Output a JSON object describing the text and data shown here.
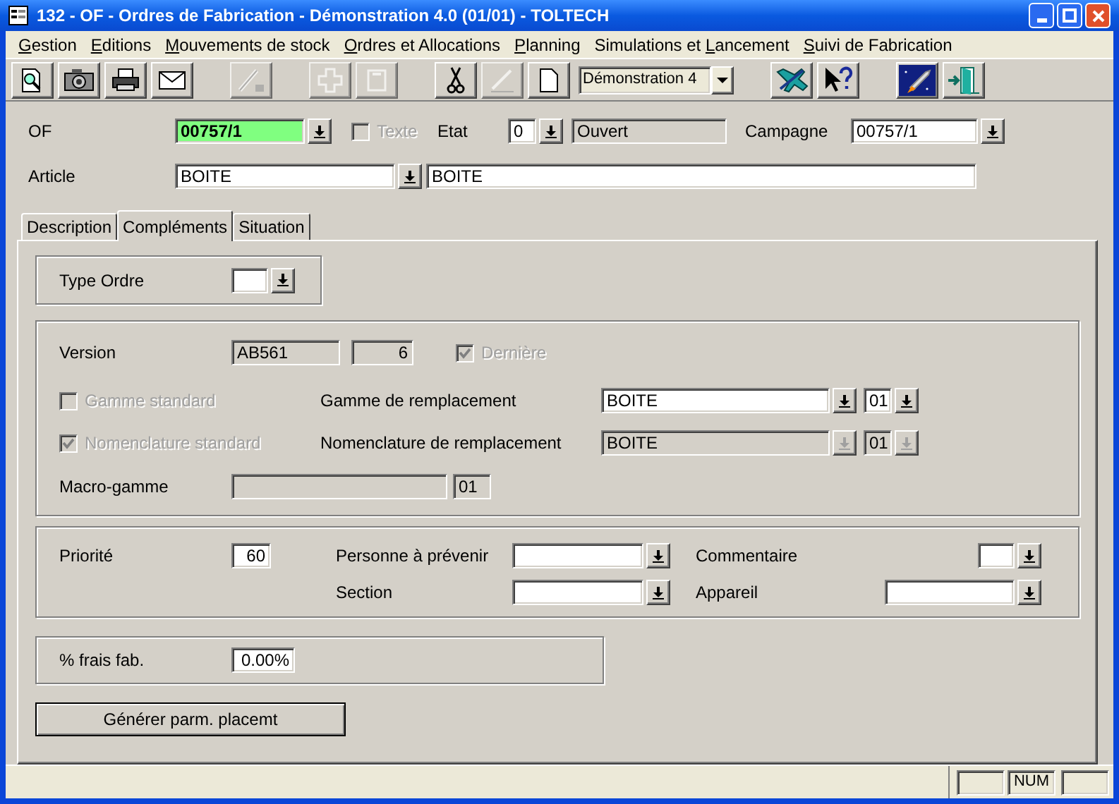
{
  "window": {
    "title": "132 - OF - Ordres de Fabrication - Démonstration 4.0 (01/01) - TOLTECH"
  },
  "menu": [
    {
      "key": "G",
      "post": "estion"
    },
    {
      "key": "E",
      "post": "ditions"
    },
    {
      "key": "M",
      "post": "ouvements de stock"
    },
    {
      "key": "O",
      "post": "rdres et Allocations"
    },
    {
      "key": "P",
      "post": "lanning"
    },
    {
      "pre": "Simulations et ",
      "key": "L",
      "post": "ancement"
    },
    {
      "key": "S",
      "post": "uivi de Fabrication"
    }
  ],
  "toolbar": [
    [
      {
        "kind": "button",
        "disabled": false
      },
      {
        "kind": "button",
        "disabled": false
      },
      {
        "kind": "button",
        "disabled": false
      },
      {
        "kind": "button",
        "disabled": false
      }
    ],
    [
      {
        "kind": "button",
        "disabled": true
      }
    ],
    [
      {
        "kind": "button",
        "disabled": true
      },
      {
        "kind": "button",
        "disabled": true
      }
    ],
    [
      {
        "kind": "button",
        "disabled": false
      },
      {
        "kind": "button",
        "disabled": true
      },
      {
        "kind": "button",
        "disabled": false
      },
      {
        "kind": "combo",
        "value": "Démonstration 4"
      }
    ],
    [
      {
        "kind": "button",
        "disabled": false
      },
      {
        "kind": "button",
        "disabled": false
      }
    ],
    [
      {
        "kind": "button",
        "disabled": false
      },
      {
        "kind": "button",
        "disabled": false
      }
    ]
  ],
  "header": {
    "of": {
      "label": "OF",
      "field": {
        "value": "00757/1",
        "highlighted": true,
        "disabled": false,
        "dropdown": {
          "disabled": false
        }
      }
    },
    "texte": {
      "label": "Texte",
      "checked": false,
      "disabled": true
    },
    "etat": {
      "label": "Etat",
      "code": {
        "value": "0",
        "disabled": false,
        "dropdown": {
          "disabled": false
        }
      },
      "status": {
        "value": "Ouvert",
        "disabled": true
      }
    },
    "campagne": {
      "label": "Campagne",
      "field": {
        "value": "00757/1",
        "disabled": false,
        "dropdown": {
          "disabled": false
        }
      }
    },
    "article": {
      "label": "Article",
      "code": {
        "value": "BOITE",
        "disabled": false,
        "dropdown": {
          "disabled": false
        }
      },
      "description": {
        "value": "BOITE",
        "disabled": false
      }
    }
  },
  "tabs": [
    {
      "label": "Description",
      "selected": false
    },
    {
      "label": "Compléments",
      "selected": true
    },
    {
      "label": "Situation",
      "selected": false
    }
  ],
  "complements": {
    "type_ordre": {
      "label": "Type Ordre",
      "field": {
        "disabled": false,
        "dropdown": {
          "disabled": false
        }
      }
    },
    "version": {
      "label": "Version",
      "code": {
        "value": "AB561",
        "disabled": true
      },
      "number": {
        "value": "6",
        "disabled": true
      },
      "derniere": {
        "label": "Dernière",
        "checked": true,
        "disabled": true
      }
    },
    "gamme": {
      "standard": {
        "label": "Gamme standard",
        "checked": false,
        "disabled": true
      },
      "label": "Gamme de remplacement",
      "field": {
        "value": "BOITE",
        "disabled": false,
        "dropdown": {
          "disabled": false
        }
      },
      "version": {
        "value": "01",
        "disabled": false,
        "dropdown": {
          "disabled": false
        }
      }
    },
    "nomenclature": {
      "standard": {
        "label": "Nomenclature standard",
        "checked": true,
        "disabled": true
      },
      "label": "Nomenclature de remplacement",
      "field": {
        "value": "BOITE",
        "disabled": true,
        "dropdown": {
          "disabled": true
        }
      },
      "version": {
        "value": "01",
        "disabled": true,
        "dropdown": {
          "disabled": true
        }
      }
    },
    "macro_gamme": {
      "label": "Macro-gamme",
      "field": {
        "disabled": true
      },
      "version": {
        "value": "01",
        "disabled": true
      }
    },
    "priorite": {
      "label": "Priorité",
      "field": {
        "value": "60",
        "disabled": false
      }
    },
    "personne": {
      "label": "Personne à prévenir",
      "field": {
        "disabled": false,
        "dropdown": {
          "disabled": false
        }
      }
    },
    "commentaire": {
      "label": "Commentaire",
      "field": {
        "disabled": false,
        "dropdown": {
          "disabled": false
        }
      }
    },
    "section": {
      "label": "Section",
      "field": {
        "disabled": false,
        "dropdown": {
          "disabled": false
        }
      }
    },
    "appareil": {
      "label": "Appareil",
      "field": {
        "disabled": false,
        "dropdown": {
          "disabled": false
        }
      }
    },
    "frais": {
      "label": "% frais fab.",
      "field": {
        "value": "0.00%",
        "disabled": false
      }
    },
    "button": "Générer parm. placemt"
  },
  "status_bar": {
    "indicators": [
      "NUM"
    ]
  }
}
